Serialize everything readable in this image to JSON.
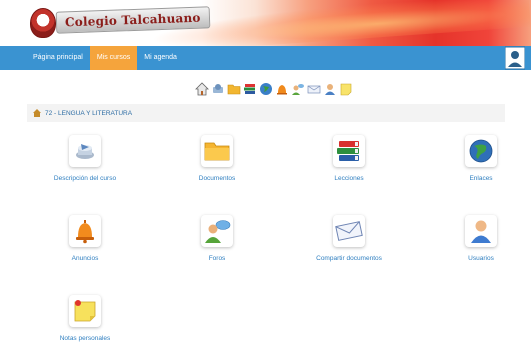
{
  "header": {
    "brand_name": "Colegio Talcahuano"
  },
  "nav": {
    "items": [
      {
        "label": "Página principal",
        "active": false
      },
      {
        "label": "Mis cursos",
        "active": true
      },
      {
        "label": "Mi agenda",
        "active": false
      }
    ],
    "colors": {
      "bar": "#3a93d1",
      "active": "#f5a43c"
    }
  },
  "toolbar": {
    "icons": [
      "home-icon",
      "description-icon",
      "folder-icon",
      "books-icon",
      "globe-icon",
      "bell-icon",
      "forum-icon",
      "envelope-icon",
      "user-icon",
      "note-icon"
    ]
  },
  "breadcrumb": {
    "text": "72 - LENGUA Y LITERATURA"
  },
  "tools": [
    {
      "label": "Descripción del curso",
      "icon": "course-description-icon"
    },
    {
      "label": "Documentos",
      "icon": "folder-icon"
    },
    {
      "label": "Lecciones",
      "icon": "books-icon"
    },
    {
      "label": "Enlaces",
      "icon": "globe-icon"
    },
    {
      "label": "Anuncios",
      "icon": "bell-icon"
    },
    {
      "label": "Foros",
      "icon": "forum-icon"
    },
    {
      "label": "Compartir documentos",
      "icon": "envelope-icon"
    },
    {
      "label": "Usuarios",
      "icon": "user-icon"
    },
    {
      "label": "Notas personales",
      "icon": "sticky-note-icon"
    }
  ]
}
